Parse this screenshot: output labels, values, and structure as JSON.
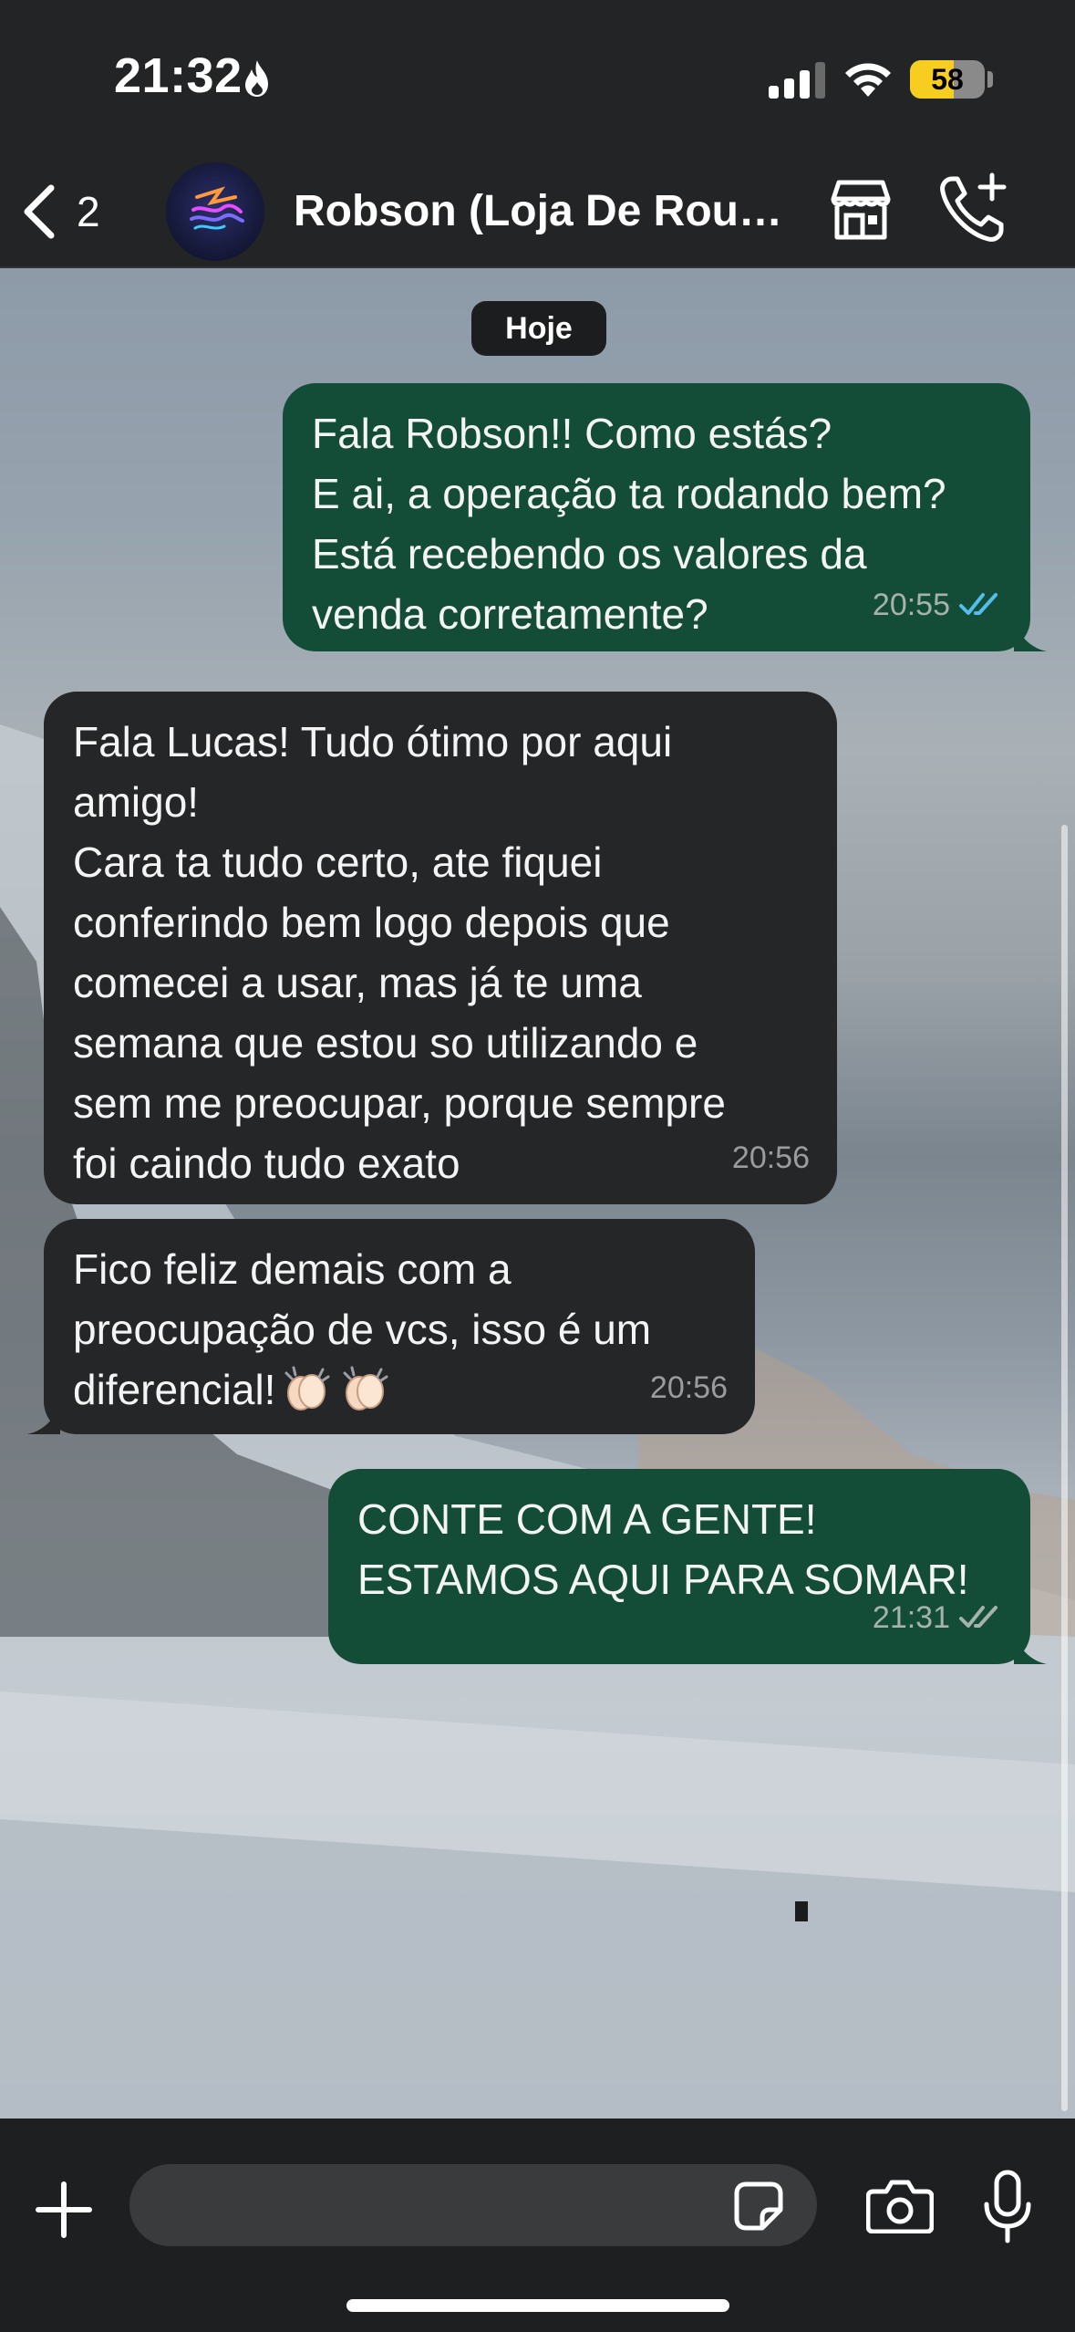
{
  "status_bar": {
    "time": "21:32",
    "battery_level": "58",
    "battery_fraction": 0.58,
    "icons": [
      "flame-icon",
      "cellular-signal-icon",
      "wifi-icon",
      "battery-icon"
    ]
  },
  "header": {
    "back_count": "2",
    "contact_name": "Robson (Loja De Roupas)",
    "icons": [
      "back-chevron-icon",
      "store-icon",
      "call-add-icon"
    ]
  },
  "chat": {
    "date_label": "Hoje",
    "messages": [
      {
        "direction": "outgoing",
        "text": "Fala Robson!! Como estás?\nE ai, a operação ta rodando bem?\nEstá recebendo os valores da\nvenda corretamente?",
        "time": "20:55",
        "status": "read"
      },
      {
        "direction": "incoming",
        "text": "Fala Lucas! Tudo ótimo por aqui\namigo!\nCara ta tudo certo, ate fiquei\nconferindo bem logo depois que\ncomecei a usar, mas já te uma\nsemana que estou so utilizando e\nsem me preocupar, porque sempre\nfoi caindo tudo exato",
        "time": "20:56"
      },
      {
        "direction": "incoming",
        "text": "Fico feliz demais com a\npreocupação de vcs, isso é um\ndiferencial!",
        "emoji": "clapping-hands-emoji",
        "time": "20:56"
      },
      {
        "direction": "outgoing",
        "text": "CONTE COM A GENTE!\nESTAMOS AQUI PARA SOMAR!",
        "time": "21:31",
        "status": "delivered"
      }
    ]
  },
  "input_bar": {
    "placeholder": "",
    "icons": [
      "plus-icon",
      "sticker-icon",
      "camera-icon",
      "microphone-icon"
    ]
  },
  "colors": {
    "outgoing_bubble": "#134d37",
    "incoming_bubble": "#242628",
    "read_ticks": "#53bdeb",
    "delivered_ticks": "#a6b2ab",
    "header_bg": "#232425",
    "battery_fill": "#f7ce1f"
  }
}
